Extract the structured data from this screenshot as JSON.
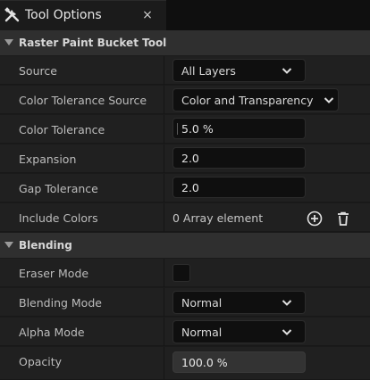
{
  "tab": {
    "title": "Tool Options",
    "close_glyph": "×",
    "icon": "tools-icon"
  },
  "sections": [
    {
      "title": "Raster Paint Bucket Tool",
      "rows": {
        "source": {
          "label": "Source",
          "value": "All Layers"
        },
        "color_tolerance_source": {
          "label": "Color Tolerance Source",
          "value": "Color and Transparency"
        },
        "color_tolerance": {
          "label": "Color Tolerance",
          "value": "5.0 %"
        },
        "expansion": {
          "label": "Expansion",
          "value": "2.0"
        },
        "gap_tolerance": {
          "label": "Gap Tolerance",
          "value": "2.0"
        },
        "include_colors": {
          "label": "Include Colors",
          "value": "0 Array element"
        }
      }
    },
    {
      "title": "Blending",
      "rows": {
        "eraser_mode": {
          "label": "Eraser Mode",
          "checked": false
        },
        "blending_mode": {
          "label": "Blending Mode",
          "value": "Normal"
        },
        "alpha_mode": {
          "label": "Alpha Mode",
          "value": "Normal"
        },
        "opacity": {
          "label": "Opacity",
          "value": "100.0 %"
        }
      }
    }
  ]
}
